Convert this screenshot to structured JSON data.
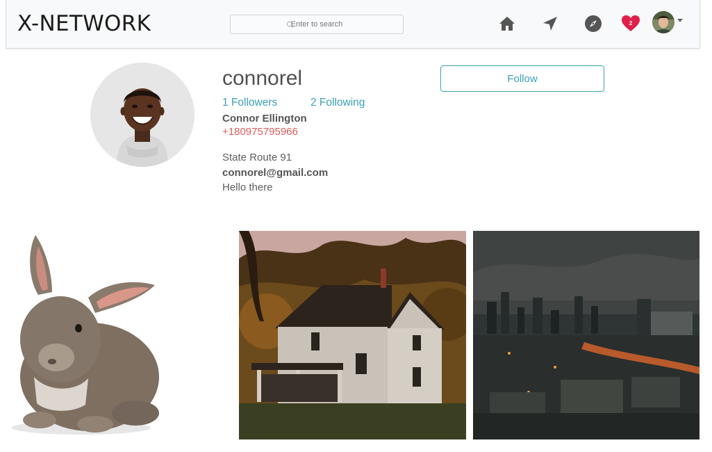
{
  "navbar": {
    "brand": "X-NETWORK",
    "search_placeholder": "Enter to search",
    "icons": [
      "home-icon",
      "direct-icon",
      "explore-icon",
      "heart-icon",
      "avatar",
      "caret-down-icon"
    ],
    "notification_count": "2",
    "accent_color": "#e0204a"
  },
  "profile": {
    "username": "connorel",
    "followers": "1 Followers",
    "following": "2 Following",
    "full_name": "Connor Ellington",
    "phone": "+180975795966",
    "address": "State Route 91",
    "email": "connorel@gmail.com",
    "bio": "Hello there",
    "follow_label": "Follow",
    "link_color": "#3aa0b4",
    "phone_color": "#de5a5a"
  },
  "posts": [
    "rabbit photo",
    "house photo",
    "city photo"
  ]
}
